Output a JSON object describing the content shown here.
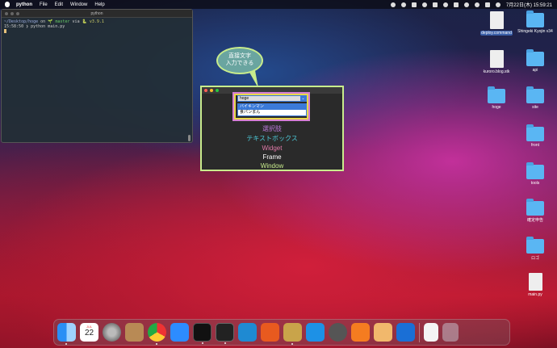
{
  "menubar": {
    "app": "python",
    "items": [
      "File",
      "Edit",
      "Window",
      "Help"
    ],
    "datetime": "7月22日(木)  15:59:21"
  },
  "terminal": {
    "title": "python",
    "line1_path": "~/Desktop/hoge",
    "line1_on": "on",
    "line1_branch": "🌱 master",
    "line1_via": "via",
    "line1_version": "🐍 v3.9.1",
    "line2_time": "15:58:50",
    "line2_cmd": "❯ python main.py"
  },
  "callout": {
    "line1": "直接文字",
    "line2": "入力できる"
  },
  "tk": {
    "combo_value": "hoge",
    "options": [
      "バイキンマン",
      "食パンまん"
    ],
    "labels": [
      "選択肢",
      "テキストボックス",
      "Widget",
      "Frame",
      "Window"
    ]
  },
  "desktop": {
    "icons": [
      {
        "label": "deploy.command",
        "type": "doc"
      },
      {
        "label": "Shingeki Kyojin v34",
        "type": "folder"
      },
      {
        "label": "kuroro.blog.stk",
        "type": "doc"
      },
      {
        "label": "api",
        "type": "folder"
      },
      {
        "label": "hoge",
        "type": "folder"
      },
      {
        "label": "site",
        "type": "folder"
      },
      {
        "label": "front",
        "type": "folder"
      },
      {
        "label": "tools",
        "type": "folder"
      },
      {
        "label": "確定申告",
        "type": "folder"
      },
      {
        "label": "ロゴ",
        "type": "folder"
      },
      {
        "label": "main.py",
        "type": "doc"
      }
    ]
  },
  "dock": {
    "calendar_month": "JUL",
    "calendar_day": "22",
    "apps": [
      "finder-icon",
      "calendar-icon",
      "system-preferences-icon",
      "contacts-icon",
      "chrome-icon",
      "zoom-icon",
      "terminal-icon",
      "terminal-alt-icon",
      "vscode-icon",
      "activity-icon",
      "python-launcher-icon",
      "docker-icon",
      "quicktime-icon",
      "sourcetree-icon",
      "preview-icon",
      "infinity-icon",
      "document-icon",
      "trash-icon"
    ]
  }
}
